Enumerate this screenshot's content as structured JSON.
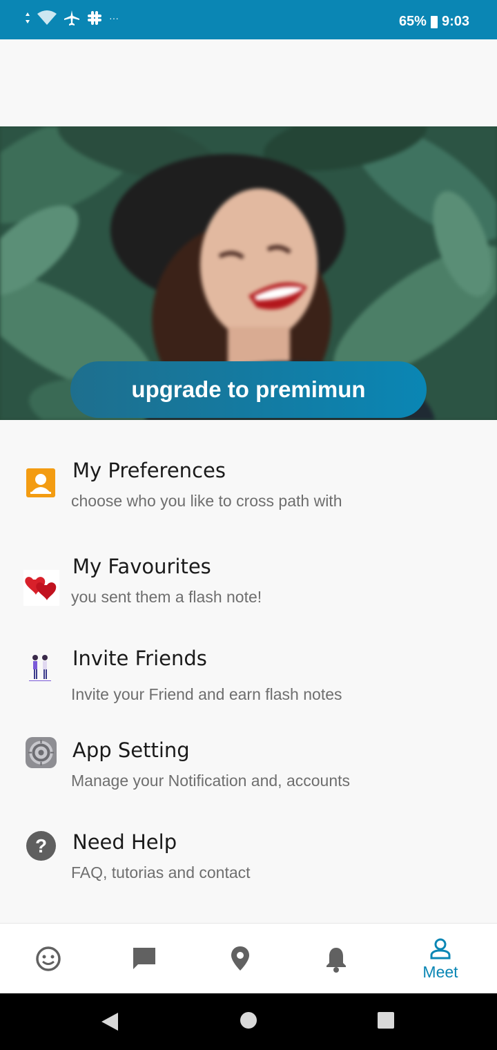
{
  "status_bar": {
    "battery": "65%",
    "time": "9:03",
    "overflow": "···"
  },
  "hero": {
    "upgrade_label": "upgrade to premimun"
  },
  "menu": [
    {
      "title": "My Preferences",
      "subtitle": "choose who you like to cross path with",
      "icon": "contact-card-icon"
    },
    {
      "title": "My Favourites",
      "subtitle": "you sent them a flash note!",
      "icon": "hearts-icon"
    },
    {
      "title": "Invite Friends",
      "subtitle": "Invite your Friend and earn flash notes",
      "icon": "friends-icon"
    },
    {
      "title": "App Setting",
      "subtitle": "Manage your Notification and, accounts",
      "icon": "settings-gear-icon"
    },
    {
      "title": "Need Help",
      "subtitle": "FAQ, tutorias and contact",
      "icon": "help-icon"
    }
  ],
  "bottom_nav": {
    "items": [
      "smiley-icon",
      "chat-icon",
      "location-icon",
      "bell-icon",
      "profile-icon"
    ],
    "active_label": "Meet"
  },
  "colors": {
    "accent": "#0a86b4",
    "status_bar": "#0a86b4"
  }
}
